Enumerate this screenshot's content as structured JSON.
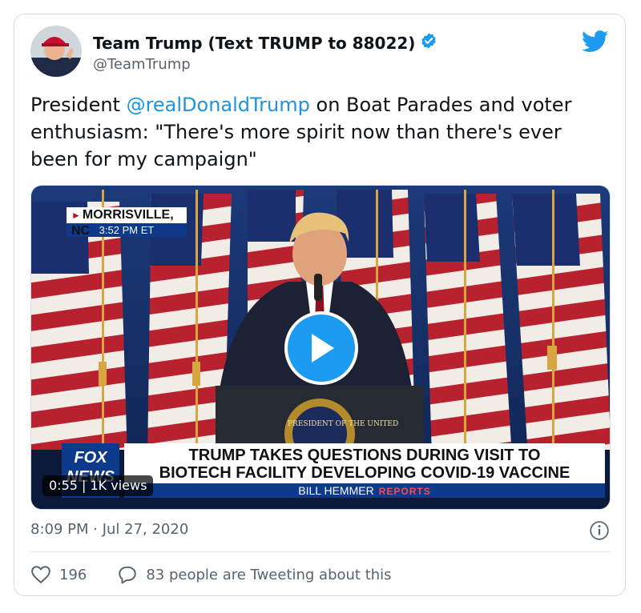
{
  "tweet": {
    "display_name": "Team Trump (Text TRUMP to 88022)",
    "handle": "@TeamTrump",
    "text_before": "President ",
    "mention": "@realDonaldTrump",
    "text_after": " on Boat Parades and voter enthusiasm: \"There's more spirit now than there's ever been for my campaign\"",
    "timestamp": "8:09 PM · Jul 27, 2020"
  },
  "video": {
    "location": "MORRISVILLE, NC",
    "local_time": "3:52 PM ET",
    "headline_line1": "TRUMP TAKES QUESTIONS DURING VISIT TO",
    "headline_line2": "BIOTECH FACILITY DEVELOPING COVID-19 VACCINE",
    "reporter": "BILL HEMMER",
    "reporter_suffix": "REPORTS",
    "network_line1": "FOX",
    "network_line2": "NEWS",
    "duration": "0:55 | 1K views",
    "seal_text": "PRESIDENT OF THE UNITED"
  },
  "actions": {
    "likes": "196",
    "replies": "83 people are Tweeting about this"
  },
  "colors": {
    "accent": "#1d9bf0",
    "mention": "#1b95e0",
    "muted": "#566370",
    "fox_blue": "#0e3a8c"
  },
  "icons": {
    "bird": "twitter-bird-icon",
    "verified": "verified-badge-icon",
    "play": "play-icon",
    "info": "info-icon",
    "like": "heart-icon",
    "reply": "speech-bubble-icon"
  }
}
